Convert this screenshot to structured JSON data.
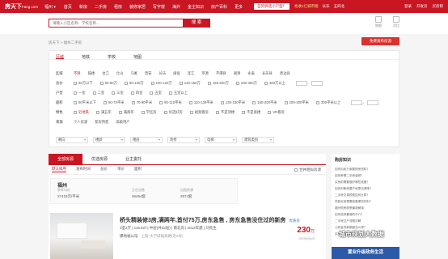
{
  "topnav": {
    "logo": "房天下",
    "logo_suffix": "Fang.com",
    "city": "福州 ▾",
    "links": [
      "首页",
      "新房",
      "二手房",
      "租房",
      "装修家居",
      "写字楼",
      "海外",
      "金主知识",
      "房产百科",
      "更多"
    ],
    "ad": "自贸拆选小户型！",
    "mid_links": [
      "抢收1亿城市版",
      "长乐",
      "五四北"
    ],
    "right_links": [
      "登录",
      "开发云",
      "买房帮"
    ]
  },
  "header": {
    "search_placeholder": "请输入小区名称、学校名称...",
    "search_button": "搜 索",
    "icons": [
      {
        "name": "map-icon",
        "label": "地图"
      },
      {
        "name": "compare-icon",
        "label": "对比"
      }
    ]
  },
  "breadcrumb": "房天下 > 福州二手房",
  "publish_button": "免费发布房源",
  "filter": {
    "tabs": [
      "区域",
      "地铁",
      "学校",
      "地图"
    ],
    "rows": [
      {
        "label": "区域",
        "options": [
          "不限",
          "鼓楼",
          "台江",
          "仓山",
          "马尾",
          "晋安",
          "长乐",
          "闽侯",
          "连江",
          "罗源",
          "平潭县",
          "闽清",
          "永泰",
          "长乐县",
          "周边县"
        ],
        "checkbox": false
      },
      {
        "label": "总价",
        "options": [
          "50万以下",
          "50-80万",
          "80-100万",
          "100-120万",
          "120-150万",
          "150-200万",
          "200-300万",
          "300万以上"
        ],
        "checkbox": true,
        "custom": "-"
      },
      {
        "label": "户型",
        "options": [
          "一室",
          "二室",
          "三室",
          "四室",
          "五室",
          "五室以上"
        ],
        "checkbox": true
      },
      {
        "label": "面积",
        "options": [
          "50平米以下",
          "50-70平米",
          "70-90平米",
          "90-110平米",
          "110-130平米",
          "130-150平米",
          "150-200平米",
          "200-300平米",
          "300平米以上"
        ],
        "checkbox": true,
        "custom": "-"
      },
      {
        "label": "特色",
        "options": [
          "近地铁",
          "满五年",
          "满两年",
          "学区房",
          "优选好房",
          "视频看房",
          "不是顶楼",
          "不是底楼",
          "VR看房"
        ],
        "checkbox": true
      },
      {
        "label": "来源",
        "options": [
          "个人房源",
          "新房预售",
          "高级用户"
        ],
        "checkbox": false
      }
    ],
    "selects": [
      "朝向",
      "楼龄",
      "楼层",
      "装修",
      "电梯",
      "建筑类别"
    ]
  },
  "listing": {
    "tabs": [
      "全部房源",
      "优选房源",
      "业主委托"
    ],
    "sort": [
      "默认排序",
      "发布时间",
      "总价",
      "单价",
      "面积"
    ],
    "sort_right": "合并相似房源",
    "estate": {
      "name": "福州",
      "stats": [
        {
          "label": "参考均价",
          "value": "27415元/平米"
        },
        {
          "label": "正在出售",
          "value": "46454套"
        },
        {
          "label": "出租房源",
          "value": "2574套"
        }
      ]
    },
    "card": {
      "title": "桥头精装修3房,满两年,首付75万,房东急售 , 房东急售没住过的新房",
      "tag": "优质房",
      "details": "3室2厅 | 119.8㎡ | 中层(共32层) | 南北向 | 2012年建 | 刘先生",
      "community": "爆地福公馆",
      "address": "上街-大学城福高路(近2号)",
      "price": "230",
      "price_unit": "万",
      "unit_price": "19199元/㎡"
    }
  },
  "sidebar": {
    "title": "购房知识",
    "items": [
      "如何向卖方索要购房资料？",
      "如何考察二手房装修？",
      "买房前需要做好哪些准备？",
      "如何判断房屋产权是否清晰？",
      "二手房交易税费如何计算？",
      "贷款买房需要准备哪些材料？",
      "福州购房政策最新解读",
      "如何选择靠谱的中介？",
      "二手房过户流程详解",
      "公积金贷款额度怎么算？",
      "买房签合同注意事项"
    ],
    "banner": "置业升级政务生活"
  },
  "watermark": "城市规划大数据",
  "colors": {
    "brand": "#c81623",
    "link": "#3a7dd1"
  }
}
